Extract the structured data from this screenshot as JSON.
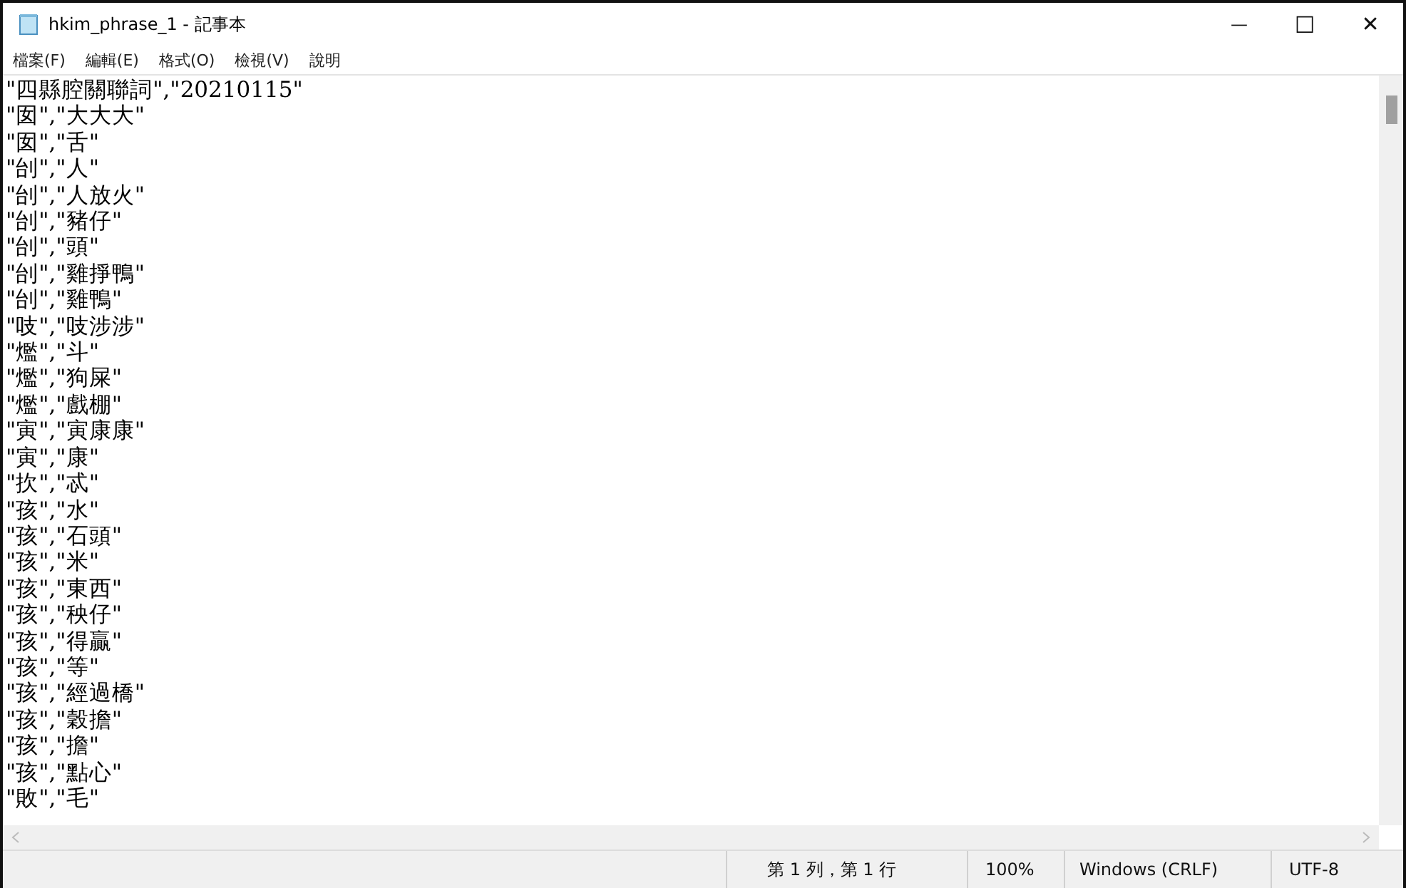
{
  "window": {
    "title": "hkim_phrase_1 - 記事本",
    "controls": [
      {
        "kind": "minimize",
        "label": "—"
      },
      {
        "kind": "maximize",
        "label": "☐"
      },
      {
        "kind": "close",
        "label": "✕"
      }
    ]
  },
  "menu": [
    "檔案(F)",
    "編輯(E)",
    "格式(O)",
    "檢視(V)",
    "說明"
  ],
  "document": {
    "lines": [
      "\"四縣腔關聯詞\",\"20210115\"",
      "\"囡\",\"大大大\"",
      "\"囡\",\"舌\"",
      "\"刣\",\"人\"",
      "\"刣\",\"人放火\"",
      "\"刣\",\"豬仔\"",
      "\"刣\",\"頭\"",
      "\"刣\",\"雞掙鴨\"",
      "\"刣\",\"雞鴨\"",
      "\"吱\",\"吱涉涉\"",
      "\"爁\",\"斗\"",
      "\"爁\",\"狗屎\"",
      "\"爁\",\"戲棚\"",
      "\"寅\",\"寅康康\"",
      "\"寅\",\"康\"",
      "\"扻\",\"忒\"",
      "\"孩\",\"水\"",
      "\"孩\",\"石頭\"",
      "\"孩\",\"米\"",
      "\"孩\",\"東西\"",
      "\"孩\",\"秧仔\"",
      "\"孩\",\"得贏\"",
      "\"孩\",\"等\"",
      "\"孩\",\"經過橋\"",
      "\"孩\",\"穀擔\"",
      "\"孩\",\"擔\"",
      "\"孩\",\"點心\"",
      "\"敗\",\"毛\""
    ]
  },
  "status_bar": [
    "第 1 列，第 1 行",
    "100%",
    "Windows (CRLF)",
    "UTF-8"
  ]
}
